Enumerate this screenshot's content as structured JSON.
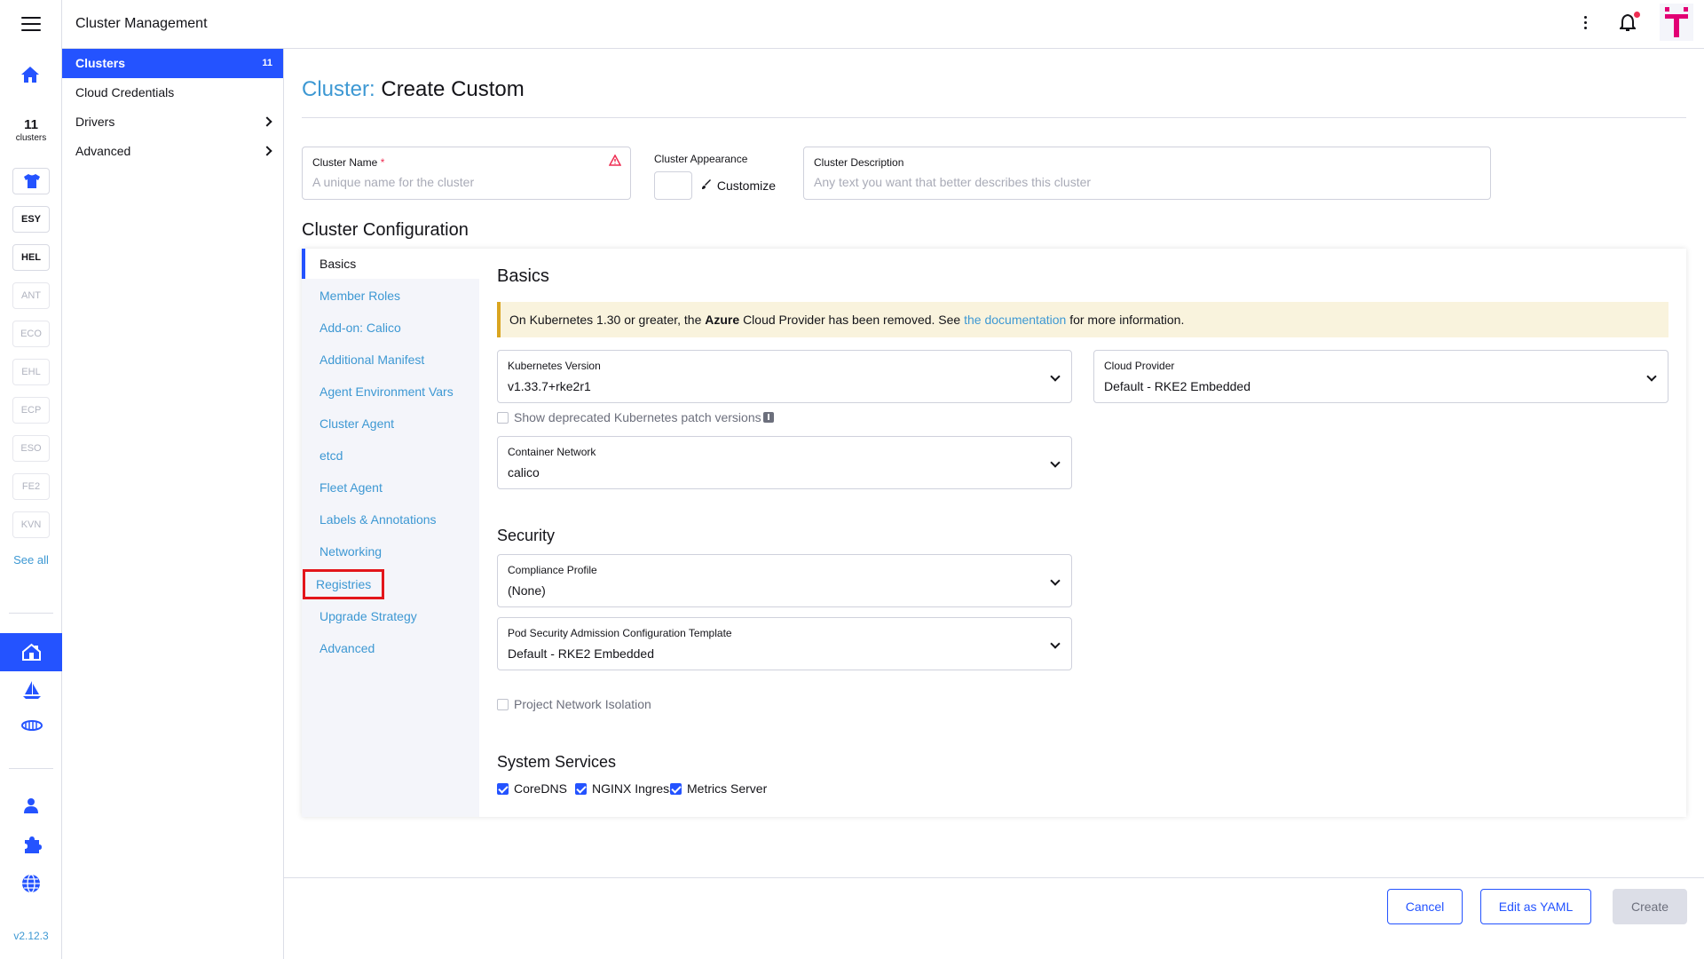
{
  "header": {
    "title": "Cluster Management"
  },
  "rail": {
    "cluster_count": "11",
    "cluster_count_label": "clusters",
    "clusters": [
      {
        "label": "",
        "icon": "tshirt-icon",
        "dim": false
      },
      {
        "label": "ESY",
        "dim": false
      },
      {
        "label": "HEL",
        "dim": false
      },
      {
        "label": "ANT",
        "dim": true
      },
      {
        "label": "ECO",
        "dim": true
      },
      {
        "label": "EHL",
        "dim": true
      },
      {
        "label": "ECP",
        "dim": true
      },
      {
        "label": "ESO",
        "dim": true
      },
      {
        "label": "FE2",
        "dim": true
      },
      {
        "label": "KVN",
        "dim": true
      }
    ],
    "see_all": "See all",
    "version": "v2.12.3"
  },
  "sidenav": {
    "items": [
      {
        "label": "Clusters",
        "count": "11",
        "active": true
      },
      {
        "label": "Cloud Credentials"
      },
      {
        "label": "Drivers",
        "expandable": true
      },
      {
        "label": "Advanced",
        "expandable": true
      }
    ]
  },
  "page": {
    "title_prefix": "Cluster:",
    "title": "Create Custom",
    "cluster_name": {
      "label": "Cluster Name",
      "required": "*",
      "placeholder": "A unique name for the cluster"
    },
    "appearance": {
      "label": "Cluster Appearance",
      "customize": "Customize"
    },
    "description": {
      "label": "Cluster Description",
      "placeholder": "Any text you want that better describes this cluster"
    },
    "config_title": "Cluster Configuration"
  },
  "tabs": [
    "Basics",
    "Member Roles",
    "Add-on: Calico",
    "Additional Manifest",
    "Agent Environment Vars",
    "Cluster Agent",
    "etcd",
    "Fleet Agent",
    "Labels & Annotations",
    "Networking",
    "Registries",
    "Upgrade Strategy",
    "Advanced"
  ],
  "basics": {
    "title": "Basics",
    "banner": {
      "pre": "On Kubernetes 1.30 or greater, the",
      "bold": "Azure",
      "mid": "Cloud Provider has been removed. See",
      "link": "the documentation",
      "post": "for more information."
    },
    "k8s_version": {
      "label": "Kubernetes Version",
      "value": "v1.33.7+rke2r1"
    },
    "cloud_provider": {
      "label": "Cloud Provider",
      "value": "Default - RKE2 Embedded"
    },
    "show_deprecated": "Show deprecated Kubernetes patch versions",
    "container_network": {
      "label": "Container Network",
      "value": "calico"
    }
  },
  "security": {
    "title": "Security",
    "compliance": {
      "label": "Compliance Profile",
      "value": "(None)"
    },
    "psa": {
      "label": "Pod Security Admission Configuration Template",
      "value": "Default - RKE2 Embedded"
    },
    "project_isolation": "Project Network Isolation"
  },
  "services": {
    "title": "System Services",
    "items": [
      "CoreDNS",
      "NGINX Ingress",
      "Metrics Server"
    ]
  },
  "footer": {
    "cancel": "Cancel",
    "edit_yaml": "Edit as YAML",
    "create": "Create"
  }
}
